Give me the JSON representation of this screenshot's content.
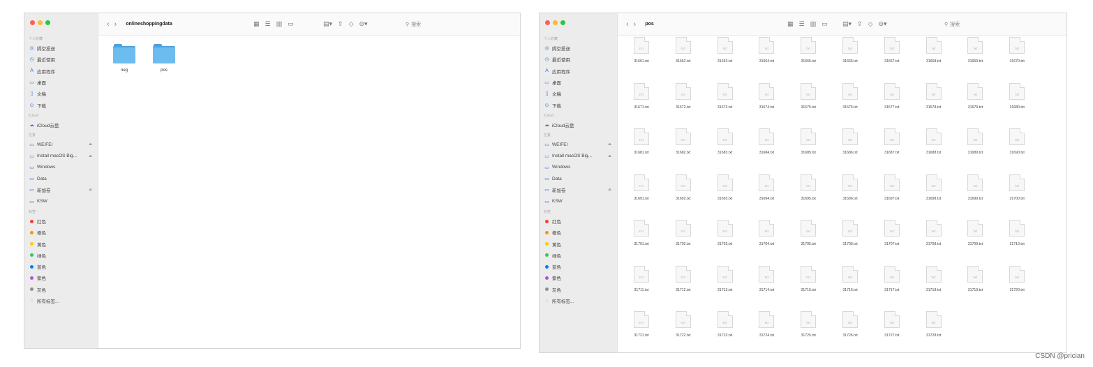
{
  "left_window": {
    "path_title": "onlineshoppingdata",
    "search_placeholder": "搜索",
    "folders": [
      {
        "name": "neg"
      },
      {
        "name": "pos"
      }
    ]
  },
  "right_window": {
    "path_title": "pos",
    "search_placeholder": "搜索",
    "file_ext_label": "TXT",
    "files": [
      "31661.txt",
      "31662.txt",
      "31663.txt",
      "31664.txt",
      "31665.txt",
      "31666.txt",
      "31667.txt",
      "31668.txt",
      "31669.txt",
      "31670.txt",
      "31671.txt",
      "31672.txt",
      "31673.txt",
      "31674.txt",
      "31675.txt",
      "31676.txt",
      "31677.txt",
      "31678.txt",
      "31679.txt",
      "31680.txt",
      "31681.txt",
      "31682.txt",
      "31683.txt",
      "31684.txt",
      "31685.txt",
      "31686.txt",
      "31687.txt",
      "31688.txt",
      "31689.txt",
      "31690.txt",
      "31691.txt",
      "31692.txt",
      "31693.txt",
      "31694.txt",
      "31695.txt",
      "31696.txt",
      "31697.txt",
      "31698.txt",
      "31699.txt",
      "31700.txt",
      "31701.txt",
      "31702.txt",
      "31703.txt",
      "31704.txt",
      "31705.txt",
      "31706.txt",
      "31707.txt",
      "31708.txt",
      "31709.txt",
      "31710.txt",
      "31711.txt",
      "31712.txt",
      "31713.txt",
      "31714.txt",
      "31715.txt",
      "31716.txt",
      "31717.txt",
      "31718.txt",
      "31719.txt",
      "31720.txt",
      "31721.txt",
      "31722.txt",
      "31723.txt",
      "31724.txt",
      "31725.txt",
      "31726.txt",
      "31727.txt",
      "31728.txt"
    ]
  },
  "sidebar": {
    "favorites_header": "个人收藏",
    "favorites": [
      {
        "label": "隔空投送",
        "icon": "airdrop-icon"
      },
      {
        "label": "最近使用",
        "icon": "clock-icon"
      },
      {
        "label": "应用程序",
        "icon": "apps-icon"
      },
      {
        "label": "桌面",
        "icon": "desktop-icon"
      },
      {
        "label": "文稿",
        "icon": "document-icon"
      },
      {
        "label": "下载",
        "icon": "download-icon"
      }
    ],
    "icloud_header": "iCloud",
    "icloud": [
      {
        "label": "iCloud云盘",
        "icon": "cloud-icon"
      }
    ],
    "locations_header": "位置",
    "locations": [
      {
        "label": "WEIFEI",
        "icon": "disk-icon",
        "eject": true
      },
      {
        "label": "Install macOS Big...",
        "icon": "disk-icon",
        "eject": true
      },
      {
        "label": "Windows",
        "icon": "disk-icon",
        "eject": false
      },
      {
        "label": "Data",
        "icon": "disk-icon",
        "eject": false
      },
      {
        "label": "新加卷",
        "icon": "disk-icon",
        "eject": true
      },
      {
        "label": "KSW",
        "icon": "disk-icon",
        "eject": false
      }
    ],
    "tags_header": "标签",
    "tags": [
      {
        "label": "红色",
        "color": "#ff3b30"
      },
      {
        "label": "橙色",
        "color": "#ff9500"
      },
      {
        "label": "黄色",
        "color": "#ffcc00"
      },
      {
        "label": "绿色",
        "color": "#34c759"
      },
      {
        "label": "蓝色",
        "color": "#007aff"
      },
      {
        "label": "紫色",
        "color": "#af52de"
      },
      {
        "label": "灰色",
        "color": "#8e8e93"
      }
    ],
    "all_tags": "所有标签..."
  },
  "watermark": "CSDN @prician"
}
